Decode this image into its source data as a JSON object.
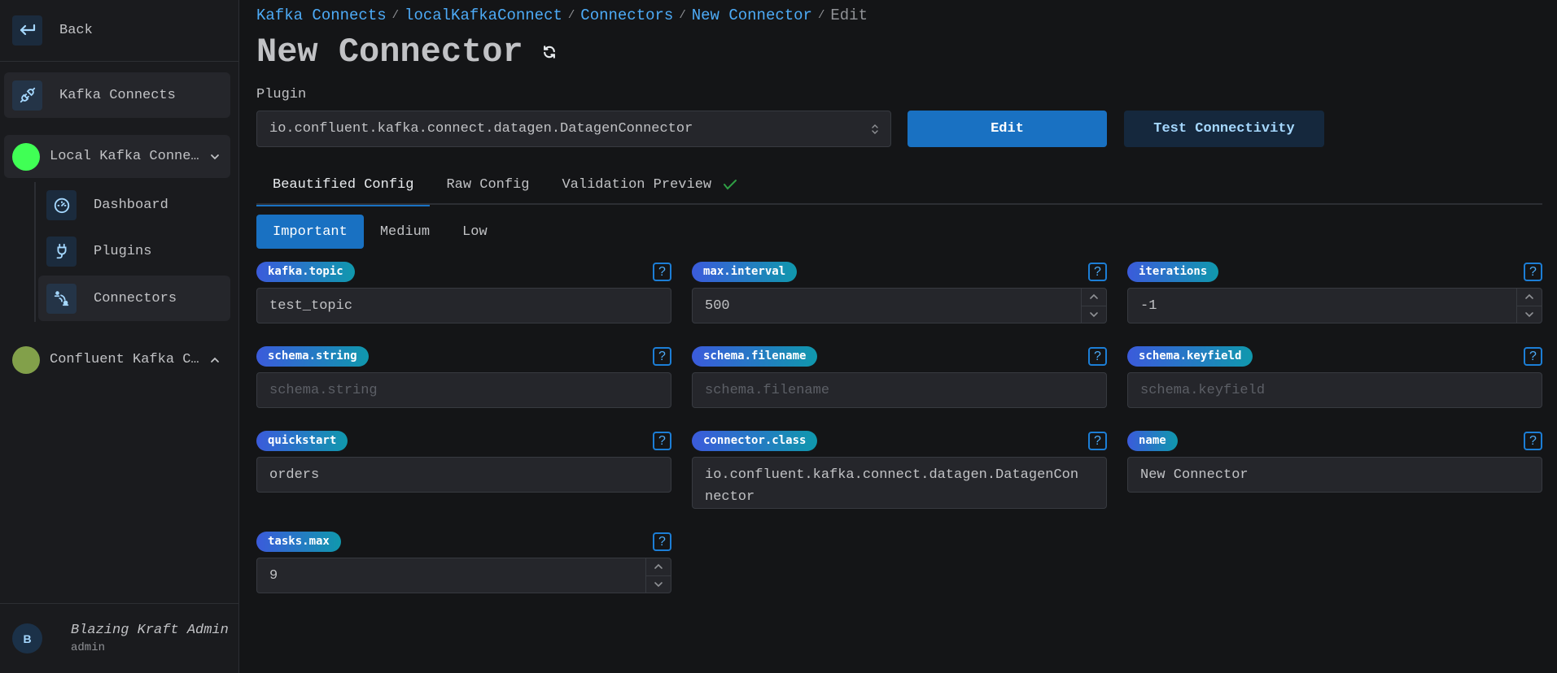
{
  "sidebar": {
    "back_label": "Back",
    "kafka_connects_label": "Kafka Connects",
    "connects": [
      {
        "name": "Local Kafka Connect",
        "display": "Local Kafka Conne…",
        "status_color": "#40ff55",
        "expanded": true
      },
      {
        "name": "Confluent Kafka Connect",
        "display": "Confluent Kafka C…",
        "status_color": "#82a04a",
        "expanded": false
      }
    ],
    "sub_items": [
      {
        "label": "Dashboard",
        "icon": "gauge-icon"
      },
      {
        "label": "Plugins",
        "icon": "plug-icon"
      },
      {
        "label": "Connectors",
        "icon": "connectors-icon",
        "active": true
      }
    ],
    "user": {
      "initial": "B",
      "name": "Blazing Kraft Admin",
      "role": "admin"
    }
  },
  "breadcrumb": [
    "Kafka Connects",
    "localKafkaConnect",
    "Connectors",
    "New Connector",
    "Edit"
  ],
  "page_title": "New Connector",
  "plugin": {
    "label": "Plugin",
    "selected": "io.confluent.kafka.connect.datagen.DatagenConnector"
  },
  "buttons": {
    "edit": "Edit",
    "test_connectivity": "Test Connectivity"
  },
  "tabs": [
    {
      "label": "Beautified Config",
      "active": true
    },
    {
      "label": "Raw Config"
    },
    {
      "label": "Validation Preview",
      "status": "valid"
    }
  ],
  "subtabs": [
    {
      "label": "Important",
      "active": true
    },
    {
      "label": "Medium"
    },
    {
      "label": "Low"
    }
  ],
  "fields": [
    {
      "key": "kafka.topic",
      "value": "test_topic",
      "type": "text"
    },
    {
      "key": "max.interval",
      "value": "500",
      "type": "number"
    },
    {
      "key": "iterations",
      "value": "-1",
      "type": "number"
    },
    {
      "key": "schema.string",
      "value": "",
      "placeholder": "schema.string",
      "type": "text"
    },
    {
      "key": "schema.filename",
      "value": "",
      "placeholder": "schema.filename",
      "type": "text"
    },
    {
      "key": "schema.keyfield",
      "value": "",
      "placeholder": "schema.keyfield",
      "type": "text"
    },
    {
      "key": "quickstart",
      "value": "orders",
      "type": "text"
    },
    {
      "key": "connector.class",
      "value": "io.confluent.kafka.connect.datagen.DatagenConnector",
      "type": "textarea"
    },
    {
      "key": "name",
      "value": "New Connector",
      "type": "text"
    },
    {
      "key": "tasks.max",
      "value": "9",
      "type": "number"
    }
  ],
  "help_glyph": "?"
}
